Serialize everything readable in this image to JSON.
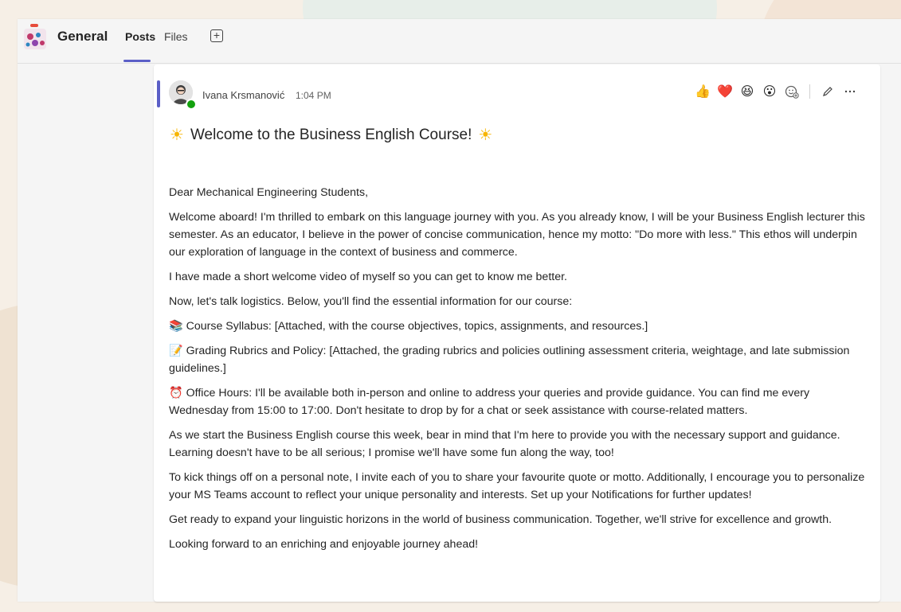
{
  "header": {
    "channel_name": "General",
    "tabs": [
      {
        "label": "Posts",
        "active": true
      },
      {
        "label": "Files",
        "active": false
      }
    ],
    "add_tab_icon": "plus-square-icon"
  },
  "post": {
    "author": "Ivana Krsmanović",
    "time": "1:04 PM",
    "presence": "available",
    "accent_color": "#5b5fc7",
    "reactions": [
      "thumbs-up",
      "heart",
      "laugh",
      "surprised",
      "add-reaction"
    ],
    "actions": [
      "edit-icon",
      "more-options-icon"
    ],
    "subject": "Welcome to the Business English Course!",
    "paragraphs": [
      "Dear Mechanical Engineering Students,",
      "Welcome aboard! I'm thrilled to embark on this language journey with you. As you already know, I will be your Business English lecturer this semester. As an educator, I believe in the power of concise communication, hence my motto: \"Do more with less.\" This ethos will underpin our exploration of language in the context of business and commerce.",
      "I have made a short welcome video of myself so you can get to know me better.",
      "Now, let's talk logistics. Below, you'll find the essential information for our course:",
      "Course Syllabus: [Attached, with the course objectives, topics, assignments, and resources.]",
      "Grading Rubrics and Policy: [Attached, the grading rubrics and policies outlining assessment criteria, weightage, and late submission guidelines.]",
      "Office Hours: I'll be available both in-person and online to address your queries and provide guidance. You can find me every Wednesday from 15:00 to 17:00. Don't hesitate to drop by for a chat or seek assistance with course-related matters.",
      "As we start the Business English course this week, bear in mind that I'm here to provide you with the necessary support and guidance. Learning doesn't have to be all serious; I promise we'll have some fun along the way, too!",
      "To kick things off on a personal note, I invite each of you to share your favourite quote or motto. Additionally, I encourage you to personalize your MS Teams account to reflect your unique personality and interests. Set up your Notifications for further updates!",
      "Get ready to expand your linguistic horizons in the world of business communication. Together, we'll strive for excellence and growth.",
      "Looking forward to an enriching and enjoyable journey ahead!"
    ],
    "bullet_icons": [
      "books-icon",
      "memo-icon",
      "alarm-clock-icon"
    ]
  }
}
